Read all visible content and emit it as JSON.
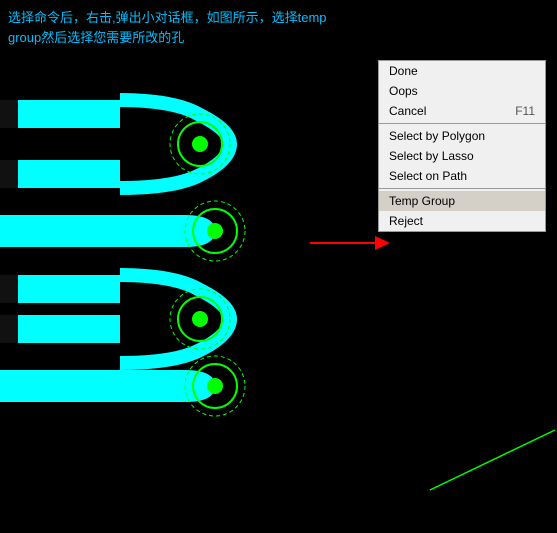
{
  "instruction": {
    "text": "选择命令后，右击,弹出小对话框，如图所示，选择temp group然后选择您需要所改的孔"
  },
  "context_menu": {
    "items": [
      {
        "id": "done",
        "label": "Done",
        "shortcut": ""
      },
      {
        "id": "oops",
        "label": "Oops",
        "shortcut": ""
      },
      {
        "id": "cancel",
        "label": "Cancel",
        "shortcut": "F11"
      },
      {
        "separator": true
      },
      {
        "id": "select-by-polygon",
        "label": "Select by Polygon",
        "shortcut": ""
      },
      {
        "id": "select-by-lasso",
        "label": "Select by Lasso",
        "shortcut": ""
      },
      {
        "id": "select-on-path",
        "label": "Select on Path",
        "shortcut": ""
      },
      {
        "separator": true
      },
      {
        "id": "temp-group",
        "label": "Temp Group",
        "shortcut": "",
        "highlighted": true
      },
      {
        "id": "reject",
        "label": "Reject",
        "shortcut": ""
      }
    ]
  },
  "colors": {
    "cyan": "#00ffff",
    "green": "#00ff00",
    "black": "#000000",
    "menu_bg": "#f0f0f0",
    "menu_highlight": "#d4d0c8",
    "red": "#ff0000",
    "instruction_color": "#00bfff"
  }
}
